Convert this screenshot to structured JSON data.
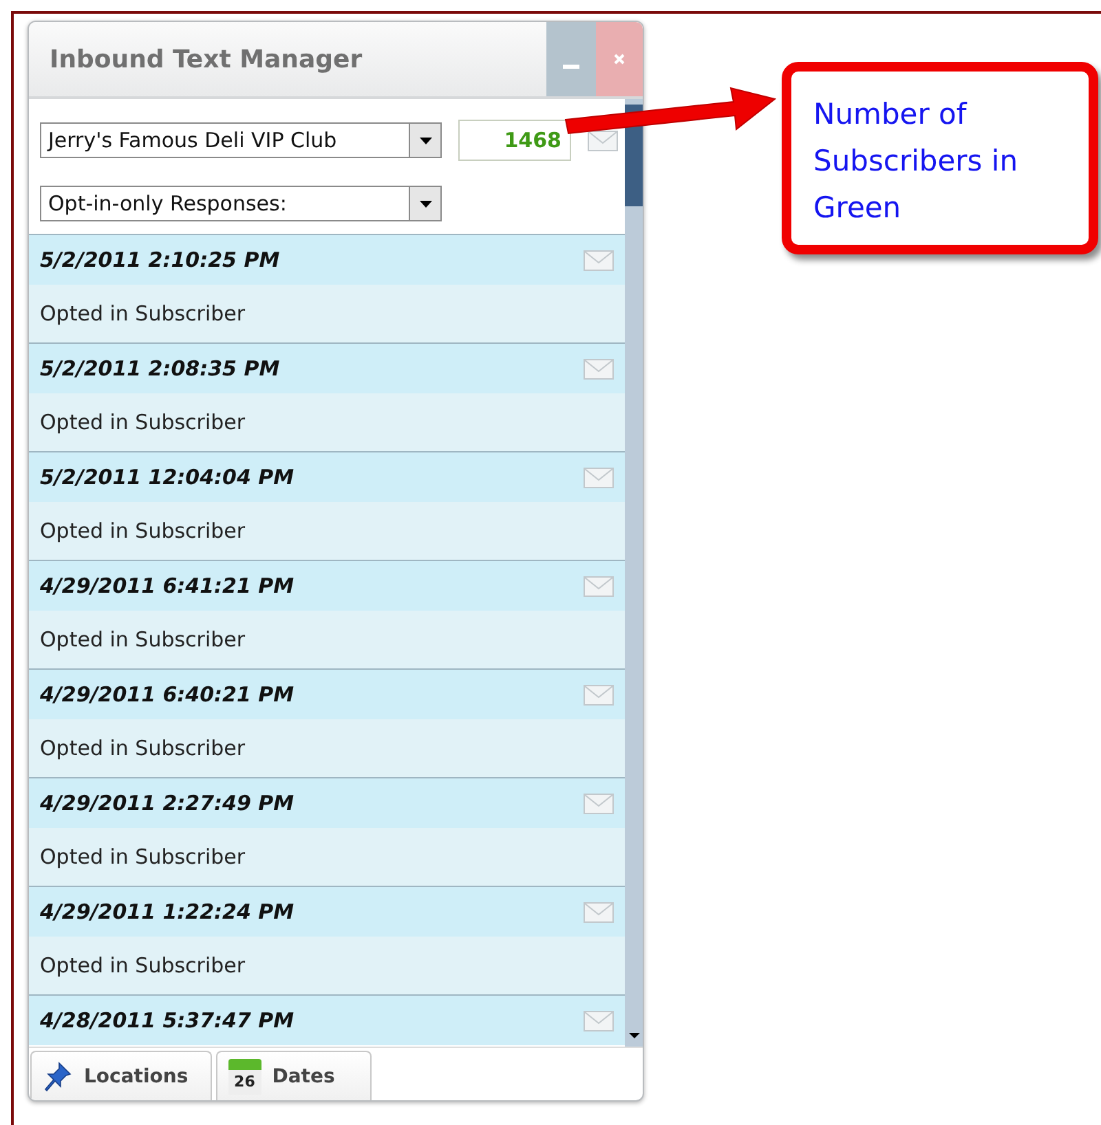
{
  "window": {
    "title": "Inbound Text Manager"
  },
  "club_select": {
    "value": "Jerry's Famous Deli VIP Club"
  },
  "subscriber_count": "1468",
  "filter_select": {
    "value": "Opt-in-only Responses:"
  },
  "messages": [
    {
      "time": "5/2/2011 2:10:25 PM",
      "text": "Opted in Subscriber"
    },
    {
      "time": "5/2/2011 2:08:35 PM",
      "text": "Opted in Subscriber"
    },
    {
      "time": "5/2/2011 12:04:04 PM",
      "text": "Opted in Subscriber"
    },
    {
      "time": "4/29/2011 6:41:21 PM",
      "text": "Opted in Subscriber"
    },
    {
      "time": "4/29/2011 6:40:21 PM",
      "text": "Opted in Subscriber"
    },
    {
      "time": "4/29/2011 2:27:49 PM",
      "text": "Opted in Subscriber"
    },
    {
      "time": "4/29/2011 1:22:24 PM",
      "text": "Opted in Subscriber"
    },
    {
      "time": "4/28/2011 5:37:47 PM"
    }
  ],
  "tabs": [
    {
      "label": "Locations",
      "kind": "pin"
    },
    {
      "label": "Dates",
      "kind": "calendar",
      "icon_text": "26"
    }
  ],
  "callout": {
    "text": "Number of Subscribers in Green"
  }
}
